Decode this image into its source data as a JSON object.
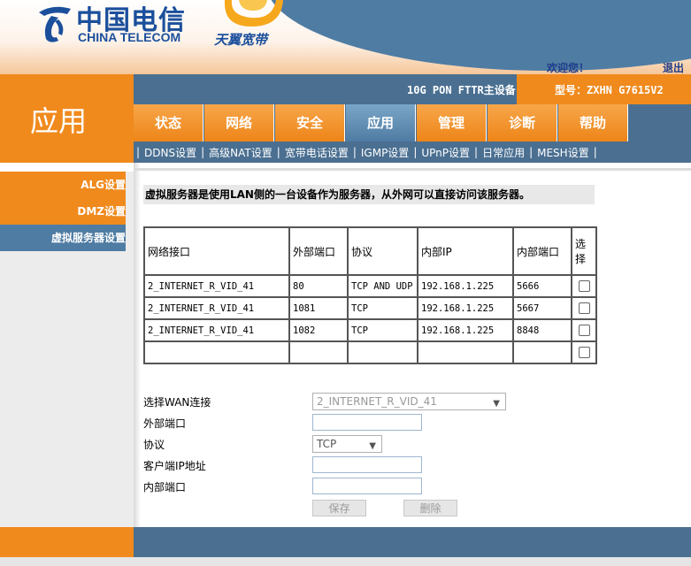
{
  "header": {
    "brand_cn": "中国电信",
    "brand_en": "CHINA TELECOM",
    "sub_brand": "天翼宽带",
    "welcome": "欢迎您！",
    "logout": "退出"
  },
  "app_title": "应用",
  "device_label": "10G PON FTTR主设备",
  "model_label": "型号：ZXHN G7615V2",
  "tabs": [
    {
      "label": "状态",
      "active": false
    },
    {
      "label": "网络",
      "active": false
    },
    {
      "label": "安全",
      "active": false
    },
    {
      "label": "应用",
      "active": true
    },
    {
      "label": "管理",
      "active": false
    },
    {
      "label": "诊断",
      "active": false
    },
    {
      "label": "帮助",
      "active": false
    }
  ],
  "subnav": [
    "DDNS设置",
    "高级NAT设置",
    "宽带电话设置",
    "IGMP设置",
    "UPnP设置",
    "日常应用",
    "MESH设置"
  ],
  "subnav_active": "高级NAT设置",
  "sidebar": [
    {
      "label": "ALG设置",
      "active": false
    },
    {
      "label": "DMZ设置",
      "active": false
    },
    {
      "label": "虚拟服务器设置",
      "active": true
    }
  ],
  "description": "虚拟服务器是使用LAN侧的一台设备作为服务器，从外网可以直接访问该服务器。",
  "table": {
    "headers": [
      "网络接口",
      "外部端口",
      "协议",
      "内部IP",
      "内部端口",
      "选择"
    ],
    "rows": [
      [
        "2_INTERNET_R_VID_41",
        "80",
        "TCP AND UDP",
        "192.168.1.225",
        "5666"
      ],
      [
        "2_INTERNET_R_VID_41",
        "1081",
        "TCP",
        "192.168.1.225",
        "5667"
      ],
      [
        "2_INTERNET_R_VID_41",
        "1082",
        "TCP",
        "192.168.1.225",
        "8848"
      ],
      [
        "",
        "",
        "",
        "",
        ""
      ]
    ]
  },
  "form": {
    "wan_label": "选择WAN连接",
    "wan_value": "2_INTERNET_R_VID_41",
    "ext_port_label": "外部端口",
    "protocol_label": "协议",
    "protocol_value": "TCP",
    "client_ip_label": "客户端IP地址",
    "int_port_label": "内部端口",
    "save_label": "保存",
    "delete_label": "删除"
  },
  "colors": {
    "orange": "#f08a1d",
    "blue": "#4a6f91",
    "brand_blue": "#1b4f9c"
  }
}
